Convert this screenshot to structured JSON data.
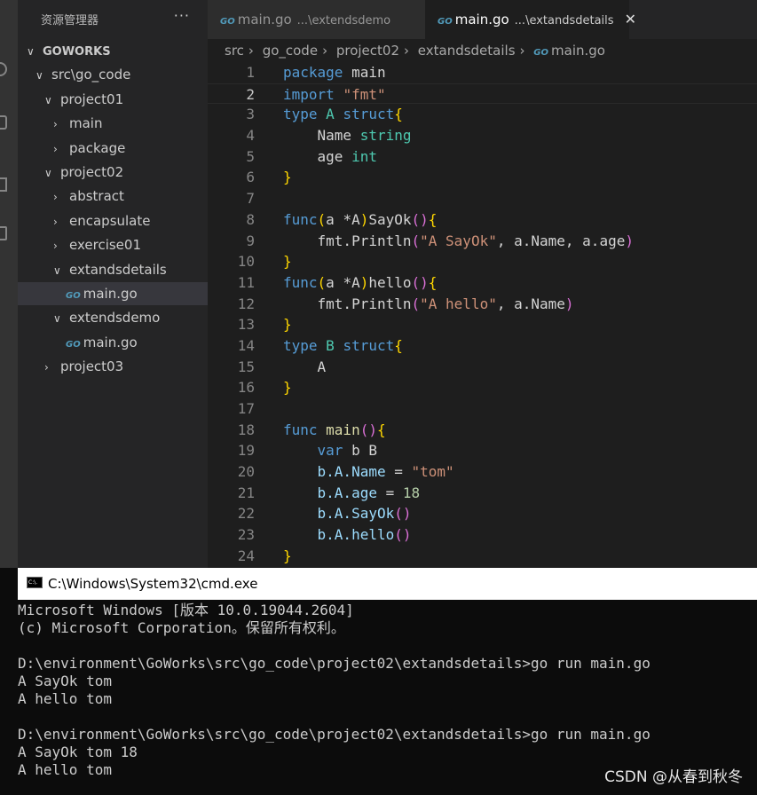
{
  "sidebar": {
    "title": "资源管理器",
    "more": "···",
    "tree": [
      {
        "label": "GOWORKS",
        "depth": 0,
        "chevron": "down",
        "bold": true
      },
      {
        "label": "src\\go_code",
        "depth": 1,
        "chevron": "down"
      },
      {
        "label": "project01",
        "depth": 2,
        "chevron": "down"
      },
      {
        "label": "main",
        "depth": 3,
        "chevron": "right"
      },
      {
        "label": "package",
        "depth": 3,
        "chevron": "right"
      },
      {
        "label": "project02",
        "depth": 2,
        "chevron": "down"
      },
      {
        "label": "abstract",
        "depth": 3,
        "chevron": "right"
      },
      {
        "label": "encapsulate",
        "depth": 3,
        "chevron": "right"
      },
      {
        "label": "exercise01",
        "depth": 3,
        "chevron": "right"
      },
      {
        "label": "extandsdetails",
        "depth": 3,
        "chevron": "down"
      },
      {
        "label": "main.go",
        "depth": 4,
        "file": true,
        "selected": true
      },
      {
        "label": "extendsdemo",
        "depth": 3,
        "chevron": "down"
      },
      {
        "label": "main.go",
        "depth": 4,
        "file": true
      },
      {
        "label": "project03",
        "depth": 2,
        "chevron": "right"
      }
    ]
  },
  "tabs": [
    {
      "name": "main.go",
      "desc": "...\\extendsdemo"
    },
    {
      "name": "main.go",
      "desc": "...\\extandsdetails",
      "close": "✕"
    }
  ],
  "go_icon": "GO",
  "breadcrumb": [
    "src",
    "go_code",
    "project02",
    "extandsdetails",
    "main.go"
  ],
  "code": [
    [
      [
        "package",
        "kw"
      ],
      [
        " main",
        "pl"
      ]
    ],
    [
      [
        "import",
        "kw"
      ],
      [
        " ",
        "pl"
      ],
      [
        "\"fmt\"",
        "str"
      ]
    ],
    [
      [
        "type",
        "kw"
      ],
      [
        " A ",
        "ty"
      ],
      [
        "struct",
        "kw"
      ],
      [
        "{",
        "br"
      ]
    ],
    [
      [
        "    Name ",
        "pl"
      ],
      [
        "string",
        "ty"
      ]
    ],
    [
      [
        "    age ",
        "pl"
      ],
      [
        "int",
        "ty"
      ]
    ],
    [
      [
        "}",
        "br"
      ]
    ],
    [],
    [
      [
        "func",
        "kw"
      ],
      [
        "(",
        "br"
      ],
      [
        "a *A",
        "pl"
      ],
      [
        ")",
        "br"
      ],
      [
        "SayOk",
        "pl"
      ],
      [
        "()",
        "br2"
      ],
      [
        "{",
        "br"
      ]
    ],
    [
      [
        "    fmt.Println",
        "pl"
      ],
      [
        "(",
        "br2"
      ],
      [
        "\"A SayOk\"",
        "str"
      ],
      [
        ", a.Name, a.age",
        "pl"
      ],
      [
        ")",
        "br2"
      ]
    ],
    [
      [
        "}",
        "br"
      ]
    ],
    [
      [
        "func",
        "kw"
      ],
      [
        "(",
        "br"
      ],
      [
        "a *A",
        "pl"
      ],
      [
        ")",
        "br"
      ],
      [
        "hello",
        "pl"
      ],
      [
        "()",
        "br2"
      ],
      [
        "{",
        "br"
      ]
    ],
    [
      [
        "    fmt.Println",
        "pl"
      ],
      [
        "(",
        "br2"
      ],
      [
        "\"A hello\"",
        "str"
      ],
      [
        ", a.Name",
        "pl"
      ],
      [
        ")",
        "br2"
      ]
    ],
    [
      [
        "}",
        "br"
      ]
    ],
    [
      [
        "type",
        "kw"
      ],
      [
        " B ",
        "ty"
      ],
      [
        "struct",
        "kw"
      ],
      [
        "{",
        "br"
      ]
    ],
    [
      [
        "    A",
        "pl"
      ]
    ],
    [
      [
        "}",
        "br"
      ]
    ],
    [],
    [
      [
        "func",
        "kw"
      ],
      [
        " main",
        "fn"
      ],
      [
        "()",
        "br2"
      ],
      [
        "{",
        "br"
      ]
    ],
    [
      [
        "    ",
        "pl"
      ],
      [
        "var",
        "kw"
      ],
      [
        " b B",
        "pl"
      ]
    ],
    [
      [
        "    b.A.Name",
        "var"
      ],
      [
        " = ",
        "pl"
      ],
      [
        "\"tom\"",
        "str"
      ]
    ],
    [
      [
        "    b.A.age",
        "var"
      ],
      [
        " = ",
        "pl"
      ],
      [
        "18",
        "num"
      ]
    ],
    [
      [
        "    b.A.SayOk",
        "var"
      ],
      [
        "()",
        "br2"
      ]
    ],
    [
      [
        "    b.A.hello",
        "var"
      ],
      [
        "()",
        "br2"
      ]
    ],
    [
      [
        "}",
        "br"
      ]
    ]
  ],
  "current_line": 2,
  "cmd": {
    "title": "C:\\Windows\\System32\\cmd.exe",
    "icon_text": "C:\\.",
    "lines": [
      "Microsoft Windows [版本 10.0.19044.2604]",
      "(c) Microsoft Corporation。保留所有权利。",
      "",
      "D:\\environment\\GoWorks\\src\\go_code\\project02\\extandsdetails>go run main.go",
      "A SayOk tom",
      "A hello tom",
      "",
      "D:\\environment\\GoWorks\\src\\go_code\\project02\\extandsdetails>go run main.go",
      "A SayOk tom 18",
      "A hello tom"
    ]
  },
  "watermark": "CSDN @从春到秋冬"
}
